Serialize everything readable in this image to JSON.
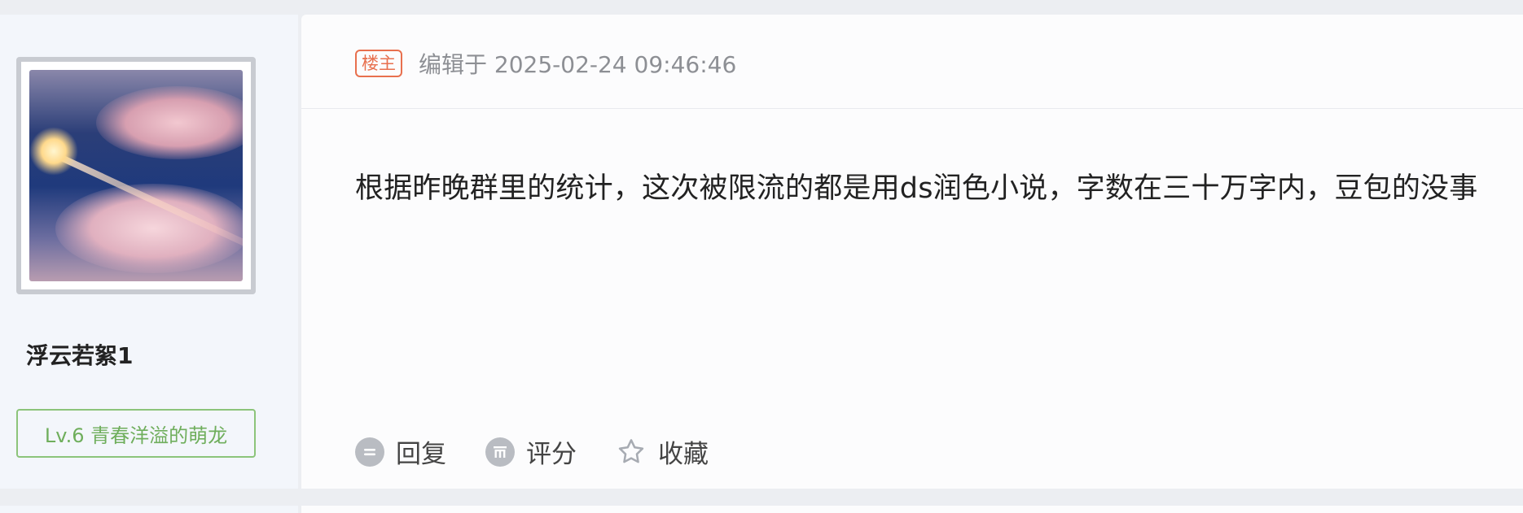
{
  "user": {
    "name": "浮云若絮1",
    "level": "Lv.6 青春洋溢的萌龙",
    "avatar_icon": "avatar-image"
  },
  "post": {
    "badge": "楼主",
    "edit_meta": "编辑于 2025-02-24 09:46:46",
    "content": "根据昨晚群里的统计，这次被限流的都是用ds润色小说，字数在三十万字内，豆包的没事"
  },
  "actions": {
    "reply": "回复",
    "rate": "评分",
    "favorite": "收藏"
  },
  "colors": {
    "op_badge": "#e8704e",
    "level_badge": "#6fae5c",
    "meta_text": "#8d8f94",
    "sidebar_bg": "#f3f6fb"
  }
}
